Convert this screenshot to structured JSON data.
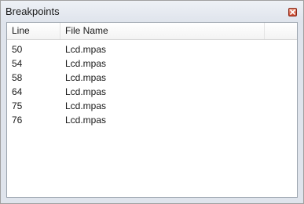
{
  "window": {
    "title": "Breakpoints",
    "close_icon": "close-icon"
  },
  "table": {
    "columns": [
      "Line",
      "File Name",
      ""
    ],
    "rows": [
      {
        "line": "50",
        "file": "Lcd.mpas"
      },
      {
        "line": "54",
        "file": "Lcd.mpas"
      },
      {
        "line": "58",
        "file": "Lcd.mpas"
      },
      {
        "line": "64",
        "file": "Lcd.mpas"
      },
      {
        "line": "75",
        "file": "Lcd.mpas"
      },
      {
        "line": "76",
        "file": "Lcd.mpas"
      }
    ]
  },
  "colors": {
    "close_button": "#c9442b",
    "title_bar": "#dfe4ec"
  }
}
